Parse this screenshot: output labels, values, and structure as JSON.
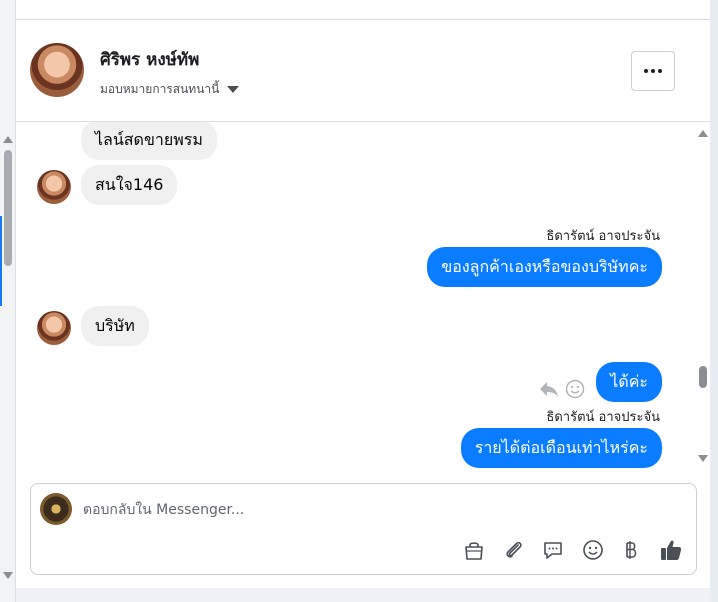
{
  "contact": {
    "name": "ศิริพร หงษ์ทัพ",
    "assign_label": "มอบหมายการสนทนานี้"
  },
  "messages": [
    {
      "direction": "incoming",
      "text": "ไลน์สดขายพรม"
    },
    {
      "direction": "incoming",
      "text": "สนใจ146"
    },
    {
      "direction": "outgoing",
      "sender": "ธิดารัตน์ อาจประจัน",
      "text": "ของลูกค้าเองหรือของบริษัทคะ"
    },
    {
      "direction": "incoming",
      "text": "บริษัท"
    },
    {
      "direction": "outgoing",
      "text": "ได้ค่ะ"
    },
    {
      "direction": "outgoing",
      "sender": "ธิดารัตน์ อาจประจัน",
      "text": "รายได้ต่อเดือนเท่าไหร่คะ"
    }
  ],
  "composer": {
    "placeholder": "ตอบกลับใน Messenger..."
  },
  "toolbar_icons": [
    "shopping-bag-icon",
    "paperclip-icon",
    "saved-reply-icon",
    "emoji-icon",
    "baht-icon",
    "thumbs-up-icon"
  ],
  "colors": {
    "outgoing_bubble": "#0a7cff",
    "incoming_bubble": "#f0f0f0",
    "thumbs_up": "#4b4f56"
  }
}
